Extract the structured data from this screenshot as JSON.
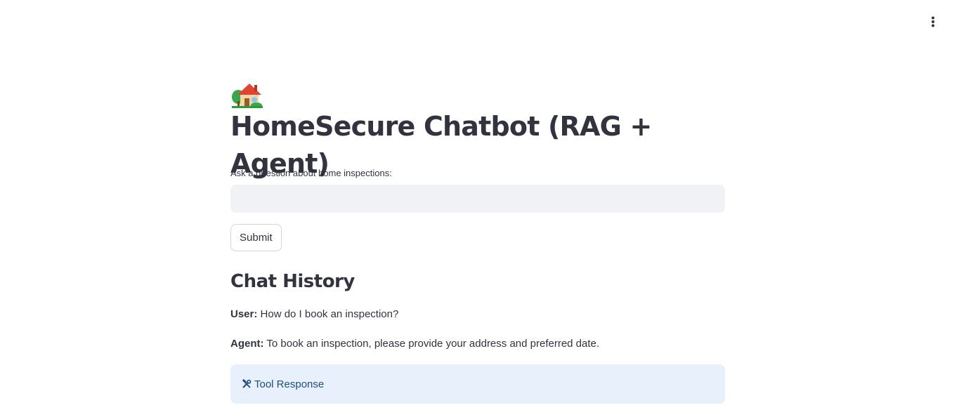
{
  "header": {
    "menu_icon": "vertical-ellipsis-icon"
  },
  "main": {
    "title_icon": "house-with-garden-icon",
    "title": "HomeSecure Chatbot (RAG + Agent)",
    "input_label": "Ask a question about home inspections:",
    "input_value": "",
    "input_placeholder": "",
    "submit_label": "Submit"
  },
  "chat": {
    "heading": "Chat History",
    "messages": [
      {
        "role_label": "User:",
        "text": " How do I book an inspection?"
      },
      {
        "role_label": "Agent:",
        "text": " To book an inspection, please provide your address and preferred date."
      }
    ],
    "tool_box": {
      "icon": "hammer-and-wrench-icon",
      "text": "Tool Response"
    }
  },
  "colors": {
    "text": "#31333f",
    "input_bg": "#f0f2f6",
    "info_bg": "#e7f0fb",
    "info_text": "#1c4e80"
  }
}
